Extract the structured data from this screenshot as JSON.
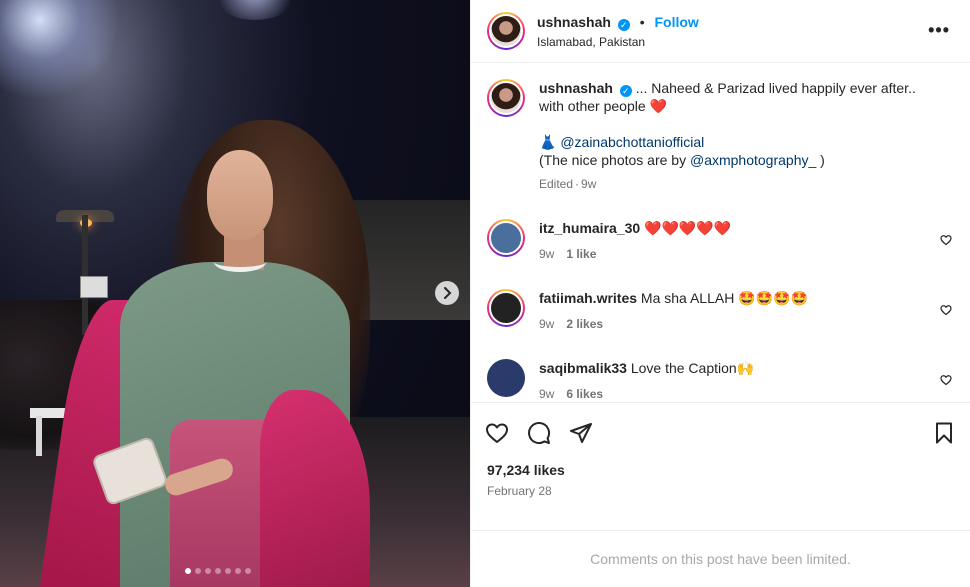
{
  "post": {
    "username": "ushnashah",
    "verified_icon": "check-badge-icon",
    "follow_label": "Follow",
    "separator": "•",
    "location": "Islamabad, Pakistan",
    "more_icon": "more-horizontal-icon",
    "more_label": "•••"
  },
  "caption": {
    "username": "ushnashah",
    "text_1": "... Naheed & Parizad lived happily ever after.. with other people",
    "emoji_heart": "❤️",
    "dress_emoji": "👗",
    "mention_1": "@zainabchottaniofficial",
    "text_2": "(The nice photos are by",
    "mention_2": "@axmphotography_",
    "text_3": ")",
    "edited": "Edited",
    "dot": "·",
    "age": "9w"
  },
  "comments": [
    {
      "username": "itz_humaira_30",
      "text": "❤️❤️❤️❤️❤️",
      "age": "9w",
      "likes": "1 like",
      "avatar_color": "#4a6f9c"
    },
    {
      "username": "fatiimah.writes",
      "text": "Ma sha ALLAH 🤩🤩🤩🤩",
      "age": "9w",
      "likes": "2 likes",
      "avatar_color": "#222222"
    },
    {
      "username": "saqibmalik33",
      "text": "Love the Caption🙌",
      "age": "9w",
      "likes": "6 likes",
      "avatar_color": "#2a3a6a"
    }
  ],
  "stats": {
    "likes": "97,234 likes",
    "date": "February 28"
  },
  "footer": {
    "limited": "Comments on this post have been limited."
  },
  "carousel": {
    "slides": 7,
    "active": 0
  },
  "colors": {
    "accent": "#0095f6",
    "like_red": "#ff3040",
    "muted": "#737373"
  }
}
